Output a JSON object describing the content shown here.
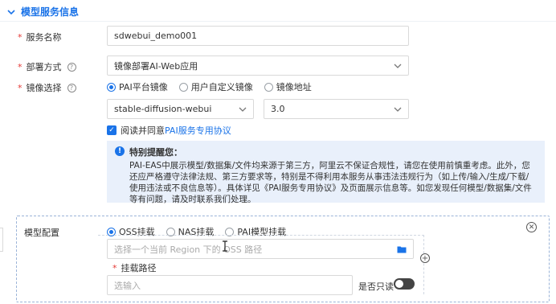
{
  "section": {
    "title": "模型服务信息"
  },
  "service_name": {
    "label": "服务名称",
    "value": "sdwebui_demo001"
  },
  "deploy_mode": {
    "label": "部署方式",
    "value": "镜像部署AI-Web应用"
  },
  "image_select": {
    "label": "镜像选择",
    "options": [
      "PAI平台镜像",
      "用户自定义镜像",
      "镜像地址"
    ],
    "selected": 0,
    "image_name": "stable-diffusion-webui",
    "image_version": "3.0"
  },
  "agreement": {
    "prefix": "阅读并同意",
    "link": "PAI服务专用协议"
  },
  "notice": {
    "title": "特别提醒您：",
    "body": "PAI-EAS中展示模型/数据集/文件均来源于第三方，阿里云不保证合规性，请您在使用前慎重考虑。此外，您还应严格遵守法律法规、第三方要求等，特别是不得利用本服务从事违法违规行为（如上传/输入/生成/下载/使用违法或不良信息等）。具体详见《PAI服务专用协议》及页面展示信息等。如您发现任何模型/数据集/文件等有问题，请及时联系我们处理。"
  },
  "model_config": {
    "label": "模型配置",
    "mount_options": [
      "OSS挂载",
      "NAS挂载",
      "PAI模型挂载"
    ],
    "selected": 0,
    "oss_placeholder": "选择一个当前 Region 下的 OSS 路径",
    "mount_path_label": "挂载路径",
    "mount_path_placeholder": "选输入",
    "readonly_label": "是否只读",
    "readonly": false
  },
  "colors": {
    "accent": "#1a73e8",
    "required": "#e53935",
    "notice_bg": "#e9f0fb"
  },
  "icons": [
    "chevron-down-icon",
    "help-icon",
    "caret-down-icon",
    "check-icon",
    "info-icon",
    "close-icon",
    "folder-icon",
    "plus-icon",
    "text-cursor-icon"
  ]
}
